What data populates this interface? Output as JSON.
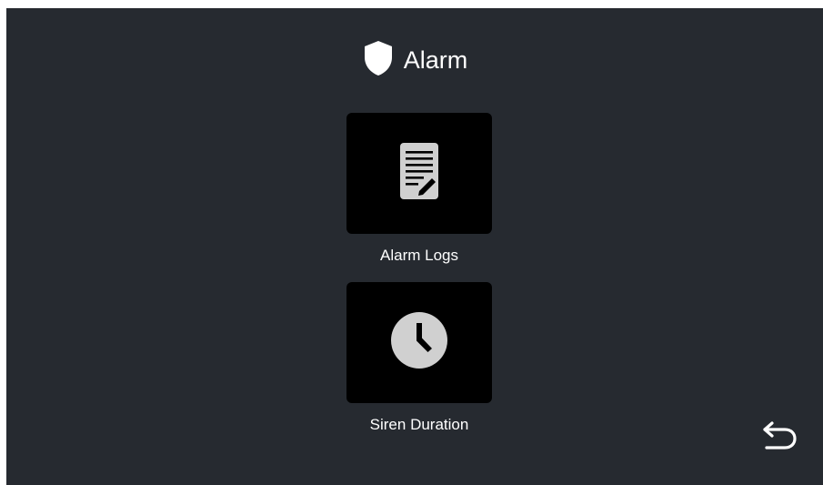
{
  "header": {
    "icon": "shield-icon",
    "title": "Alarm"
  },
  "menu": {
    "items": [
      {
        "label": "Alarm Logs",
        "icon": "document-edit-icon"
      },
      {
        "label": "Siren Duration",
        "icon": "clock-icon"
      }
    ]
  },
  "navigation": {
    "back_icon": "back-arrow-icon"
  },
  "colors": {
    "background": "#262a30",
    "tile": "#000000",
    "icon": "#d0d0d0",
    "text": "#ffffff"
  }
}
